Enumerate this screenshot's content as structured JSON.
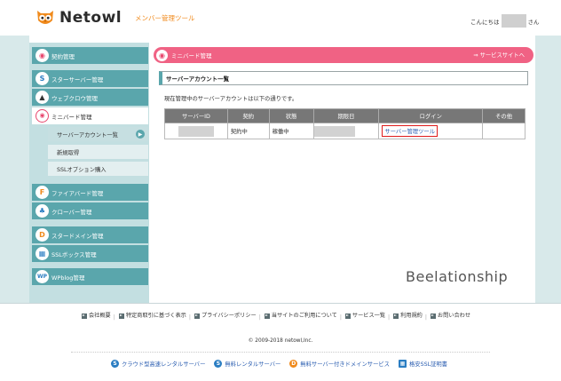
{
  "header": {
    "logo_text": "Netowl",
    "subtitle": "メンバー管理ツール",
    "greeting_prefix": "こんにちは",
    "greeting_suffix": "さん"
  },
  "sidebar": {
    "items": [
      {
        "label": "契約管理",
        "icon": "contract-icon",
        "color": "#e8466d"
      },
      {
        "label": "スターサーバー管理",
        "icon": "star-server-icon",
        "color": "#2a7dc2"
      },
      {
        "label": "ウェブクロウ管理",
        "icon": "webcrow-icon",
        "color": "#333333"
      },
      {
        "label": "ミニバード管理",
        "icon": "minibird-icon",
        "color": "#e8466d"
      },
      {
        "label": "ファイアバード管理",
        "icon": "firebird-icon",
        "color": "#f08a1c"
      },
      {
        "label": "クローバー管理",
        "icon": "clover-icon",
        "color": "#2a7dc2"
      },
      {
        "label": "スタードメイン管理",
        "icon": "star-domain-icon",
        "color": "#f08a1c"
      },
      {
        "label": "SSLボックス管理",
        "icon": "ssl-box-icon",
        "color": "#2a7dc2"
      },
      {
        "label": "WPblog管理",
        "icon": "wpblog-icon",
        "color": "#2a7dc2"
      }
    ],
    "subitems": [
      {
        "label": "サーバーアカウント一覧"
      },
      {
        "label": "新規取得"
      },
      {
        "label": "SSLオプション購入"
      }
    ]
  },
  "main": {
    "title": "ミニバード管理",
    "title_link": "⇒ サービスサイトへ",
    "section_title": "サーバーアカウント一覧",
    "intro": "現在管理中のサーバーアカウントは以下の通りです。",
    "table": {
      "headers": [
        "サーバーID",
        "契約",
        "状態",
        "期限日",
        "ログイン",
        "その他"
      ],
      "rows": [
        {
          "contract": "契約中",
          "status": "稼働中",
          "login": "サーバー管理ツール"
        }
      ]
    },
    "brand_text": "Beelationship"
  },
  "footer": {
    "links": [
      "会社概要",
      "特定商取引に基づく表示",
      "プライバシーポリシー",
      "当サイトのご利用について",
      "サービス一覧",
      "利用規約",
      "お問い合わせ"
    ],
    "copyright": "© 2009-2018 netowl,Inc.",
    "services": [
      {
        "label": "クラウド型高速レンタルサーバー",
        "icon": "star-server-icon",
        "color": "#2a7dc2"
      },
      {
        "label": "無料レンタルサーバー",
        "icon": "star-server-icon",
        "color": "#2a7dc2"
      },
      {
        "label": "無料サーバー付きドメインサービス",
        "icon": "star-domain-icon",
        "color": "#f08a1c"
      },
      {
        "label": "格安SSL証明書",
        "icon": "ssl-box-icon",
        "color": "#2a7dc2"
      }
    ]
  },
  "colors": {
    "accent_pink": "#f06284",
    "teal": "#5aa6ac",
    "login_border": "#e01b1b"
  }
}
